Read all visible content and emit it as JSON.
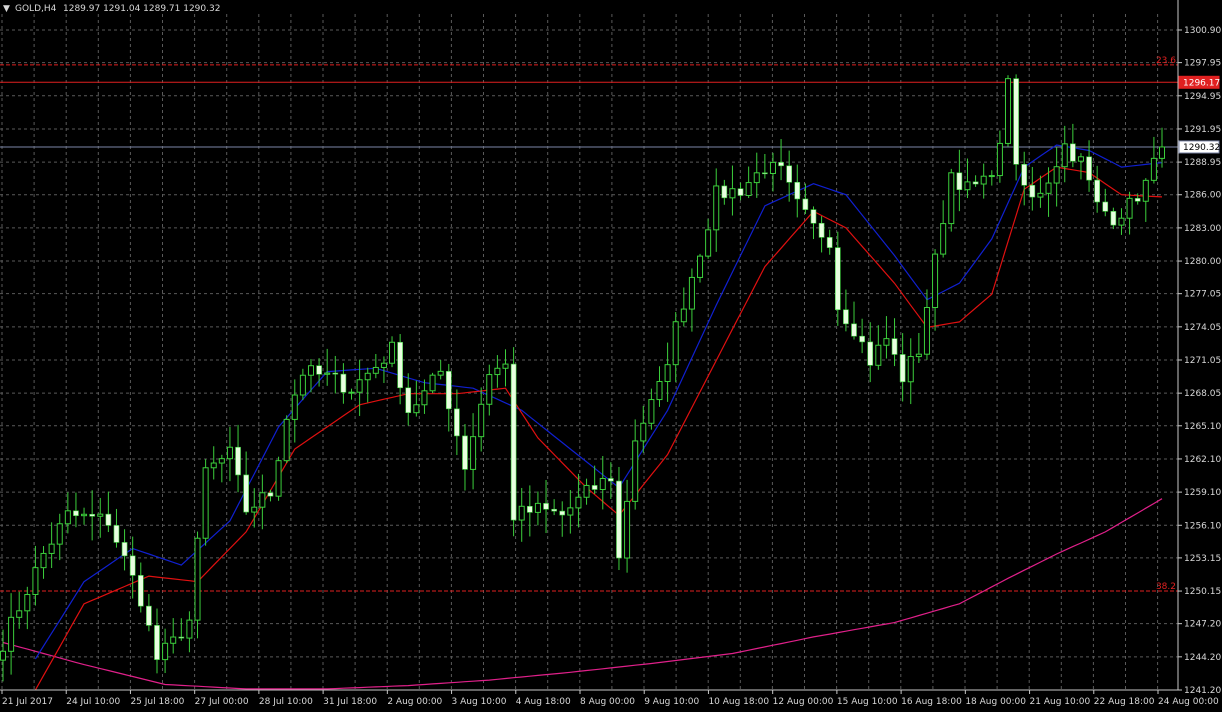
{
  "header": {
    "symbol_label": "GOLD,H4",
    "ohlc_text": "1289.97 1291.04 1289.71 1290.32"
  },
  "colors": {
    "background": "#000000",
    "grid": "#5a5a5a",
    "candle": "#e8ffe0",
    "wick": "#3ccf3c",
    "ma_fast": "#e01010",
    "ma_mid": "#1020d0",
    "ma_slow": "#e0208a",
    "fib_line": "#e02020",
    "bid_line": "#7b86a8",
    "text": "#d8d8d8"
  },
  "chart_data": {
    "type": "candlestick",
    "ylim": [
      1241.2,
      1302.7
    ],
    "yticks": [
      1300.9,
      1297.95,
      1294.95,
      1291.95,
      1288.95,
      1286.0,
      1283.0,
      1280.0,
      1277.05,
      1274.05,
      1271.05,
      1268.05,
      1265.1,
      1262.1,
      1259.1,
      1256.1,
      1253.15,
      1250.15,
      1247.2,
      1244.2,
      1241.2
    ],
    "ytick_labels": [
      "1300.90",
      "1297.95",
      "1294.95",
      "1291.95",
      "1288.95",
      "1286.00",
      "1283.00",
      "1280.00",
      "1277.05",
      "1274.05",
      "1271.05",
      "1268.05",
      "1265.10",
      "1262.10",
      "1259.10",
      "1256.10",
      "1253.15",
      "1250.15",
      "1247.20",
      "1244.20",
      "1241.20"
    ],
    "xtick_labels": [
      "21 Jul 2017",
      "24 Jul 10:00",
      "25 Jul 18:00",
      "27 Jul 00:00",
      "28 Jul 10:00",
      "31 Jul 18:00",
      "2 Aug 00:00",
      "3 Aug 10:00",
      "4 Aug 18:00",
      "8 Aug 00:00",
      "9 Aug 10:00",
      "10 Aug 18:00",
      "12 Aug 00:00",
      "15 Aug 10:00",
      "16 Aug 18:00",
      "18 Aug 00:00",
      "21 Aug 10:00",
      "22 Aug 18:00",
      "24 Aug 00:00"
    ],
    "bar_count": 144,
    "keypoints_close": [
      [
        0,
        1245.5
      ],
      [
        5,
        1253.5
      ],
      [
        8,
        1257.0
      ],
      [
        13,
        1256.5
      ],
      [
        15,
        1253.0
      ],
      [
        17,
        1249.5
      ],
      [
        19,
        1244.0
      ],
      [
        21,
        1245.5
      ],
      [
        23,
        1247.5
      ],
      [
        25,
        1261.0
      ],
      [
        28,
        1262.5
      ],
      [
        30,
        1257.5
      ],
      [
        33,
        1259.0
      ],
      [
        35,
        1266.0
      ],
      [
        37,
        1270.0
      ],
      [
        40,
        1269.5
      ],
      [
        43,
        1268.5
      ],
      [
        46,
        1270.5
      ],
      [
        48,
        1272.0
      ],
      [
        50,
        1266.5
      ],
      [
        52,
        1268.0
      ],
      [
        54,
        1270.0
      ],
      [
        57,
        1261.5
      ],
      [
        60,
        1270.0
      ],
      [
        62,
        1270.5
      ],
      [
        63,
        1257.0
      ],
      [
        66,
        1257.5
      ],
      [
        69,
        1257.0
      ],
      [
        72,
        1259.0
      ],
      [
        75,
        1260.5
      ],
      [
        76,
        1253.0
      ],
      [
        78,
        1264.0
      ],
      [
        81,
        1268.5
      ],
      [
        83,
        1274.0
      ],
      [
        86,
        1281.0
      ],
      [
        88,
        1286.0
      ],
      [
        91,
        1286.5
      ],
      [
        94,
        1288.5
      ],
      [
        96,
        1288.0
      ],
      [
        98,
        1285.0
      ],
      [
        100,
        1283.0
      ],
      [
        102,
        1282.0
      ],
      [
        103,
        1276.0
      ],
      [
        105,
        1274.0
      ],
      [
        107,
        1271.0
      ],
      [
        109,
        1273.0
      ],
      [
        111,
        1269.5
      ],
      [
        113,
        1272.0
      ],
      [
        115,
        1280.0
      ],
      [
        117,
        1288.0
      ],
      [
        119,
        1286.5
      ],
      [
        121,
        1287.0
      ],
      [
        123,
        1290.0
      ],
      [
        124,
        1297.0
      ],
      [
        125,
        1288.0
      ],
      [
        127,
        1285.5
      ],
      [
        129,
        1287.5
      ],
      [
        131,
        1290.5
      ],
      [
        133,
        1289.0
      ],
      [
        135,
        1285.0
      ],
      [
        137,
        1284.0
      ],
      [
        139,
        1285.0
      ],
      [
        141,
        1287.0
      ],
      [
        143,
        1290.32
      ]
    ],
    "ma_fast_points": [
      [
        4,
        1241.2
      ],
      [
        10,
        1249.0
      ],
      [
        18,
        1251.5
      ],
      [
        24,
        1251.0
      ],
      [
        30,
        1255.5
      ],
      [
        36,
        1263.0
      ],
      [
        44,
        1267.0
      ],
      [
        50,
        1268.0
      ],
      [
        56,
        1268.0
      ],
      [
        62,
        1268.5
      ],
      [
        66,
        1264.0
      ],
      [
        72,
        1259.5
      ],
      [
        76,
        1257.0
      ],
      [
        82,
        1262.5
      ],
      [
        88,
        1271.0
      ],
      [
        94,
        1279.5
      ],
      [
        100,
        1284.5
      ],
      [
        104,
        1283.0
      ],
      [
        110,
        1278.0
      ],
      [
        114,
        1274.0
      ],
      [
        118,
        1274.5
      ],
      [
        122,
        1277.0
      ],
      [
        126,
        1286.5
      ],
      [
        130,
        1288.5
      ],
      [
        134,
        1288.0
      ],
      [
        138,
        1286.0
      ],
      [
        143,
        1285.8
      ]
    ],
    "ma_mid_points": [
      [
        4,
        1244.0
      ],
      [
        10,
        1251.0
      ],
      [
        16,
        1254.0
      ],
      [
        22,
        1252.5
      ],
      [
        28,
        1256.5
      ],
      [
        34,
        1265.0
      ],
      [
        40,
        1270.0
      ],
      [
        46,
        1270.3
      ],
      [
        52,
        1269.0
      ],
      [
        58,
        1268.5
      ],
      [
        64,
        1266.5
      ],
      [
        70,
        1263.0
      ],
      [
        76,
        1259.5
      ],
      [
        82,
        1266.5
      ],
      [
        88,
        1276.0
      ],
      [
        94,
        1285.0
      ],
      [
        100,
        1287.0
      ],
      [
        104,
        1286.0
      ],
      [
        110,
        1280.5
      ],
      [
        114,
        1276.5
      ],
      [
        118,
        1278.0
      ],
      [
        122,
        1282.0
      ],
      [
        126,
        1288.5
      ],
      [
        130,
        1290.5
      ],
      [
        134,
        1290.0
      ],
      [
        138,
        1288.5
      ],
      [
        143,
        1288.9
      ]
    ],
    "ma_slow_points": [
      [
        0,
        1245.5
      ],
      [
        10,
        1243.5
      ],
      [
        20,
        1241.7
      ],
      [
        30,
        1241.3
      ],
      [
        40,
        1241.3
      ],
      [
        50,
        1241.6
      ],
      [
        60,
        1242.1
      ],
      [
        70,
        1242.8
      ],
      [
        80,
        1243.6
      ],
      [
        90,
        1244.5
      ],
      [
        100,
        1246.0
      ],
      [
        110,
        1247.3
      ],
      [
        118,
        1249.0
      ],
      [
        124,
        1251.3
      ],
      [
        130,
        1253.5
      ],
      [
        136,
        1255.5
      ],
      [
        143,
        1258.5
      ]
    ],
    "horizontal_levels": [
      {
        "label": "23.6",
        "value": 1297.75,
        "style": "dashed",
        "color": "#e02020"
      },
      {
        "label": "38.2",
        "value": 1250.15,
        "style": "dashed",
        "color": "#e02020"
      },
      {
        "label": "1296.17",
        "value": 1296.17,
        "style": "solid",
        "color": "#e02020"
      },
      {
        "label": "1290.32",
        "value": 1290.32,
        "style": "solid",
        "color": "#7b86a8"
      }
    ],
    "grid": true
  }
}
